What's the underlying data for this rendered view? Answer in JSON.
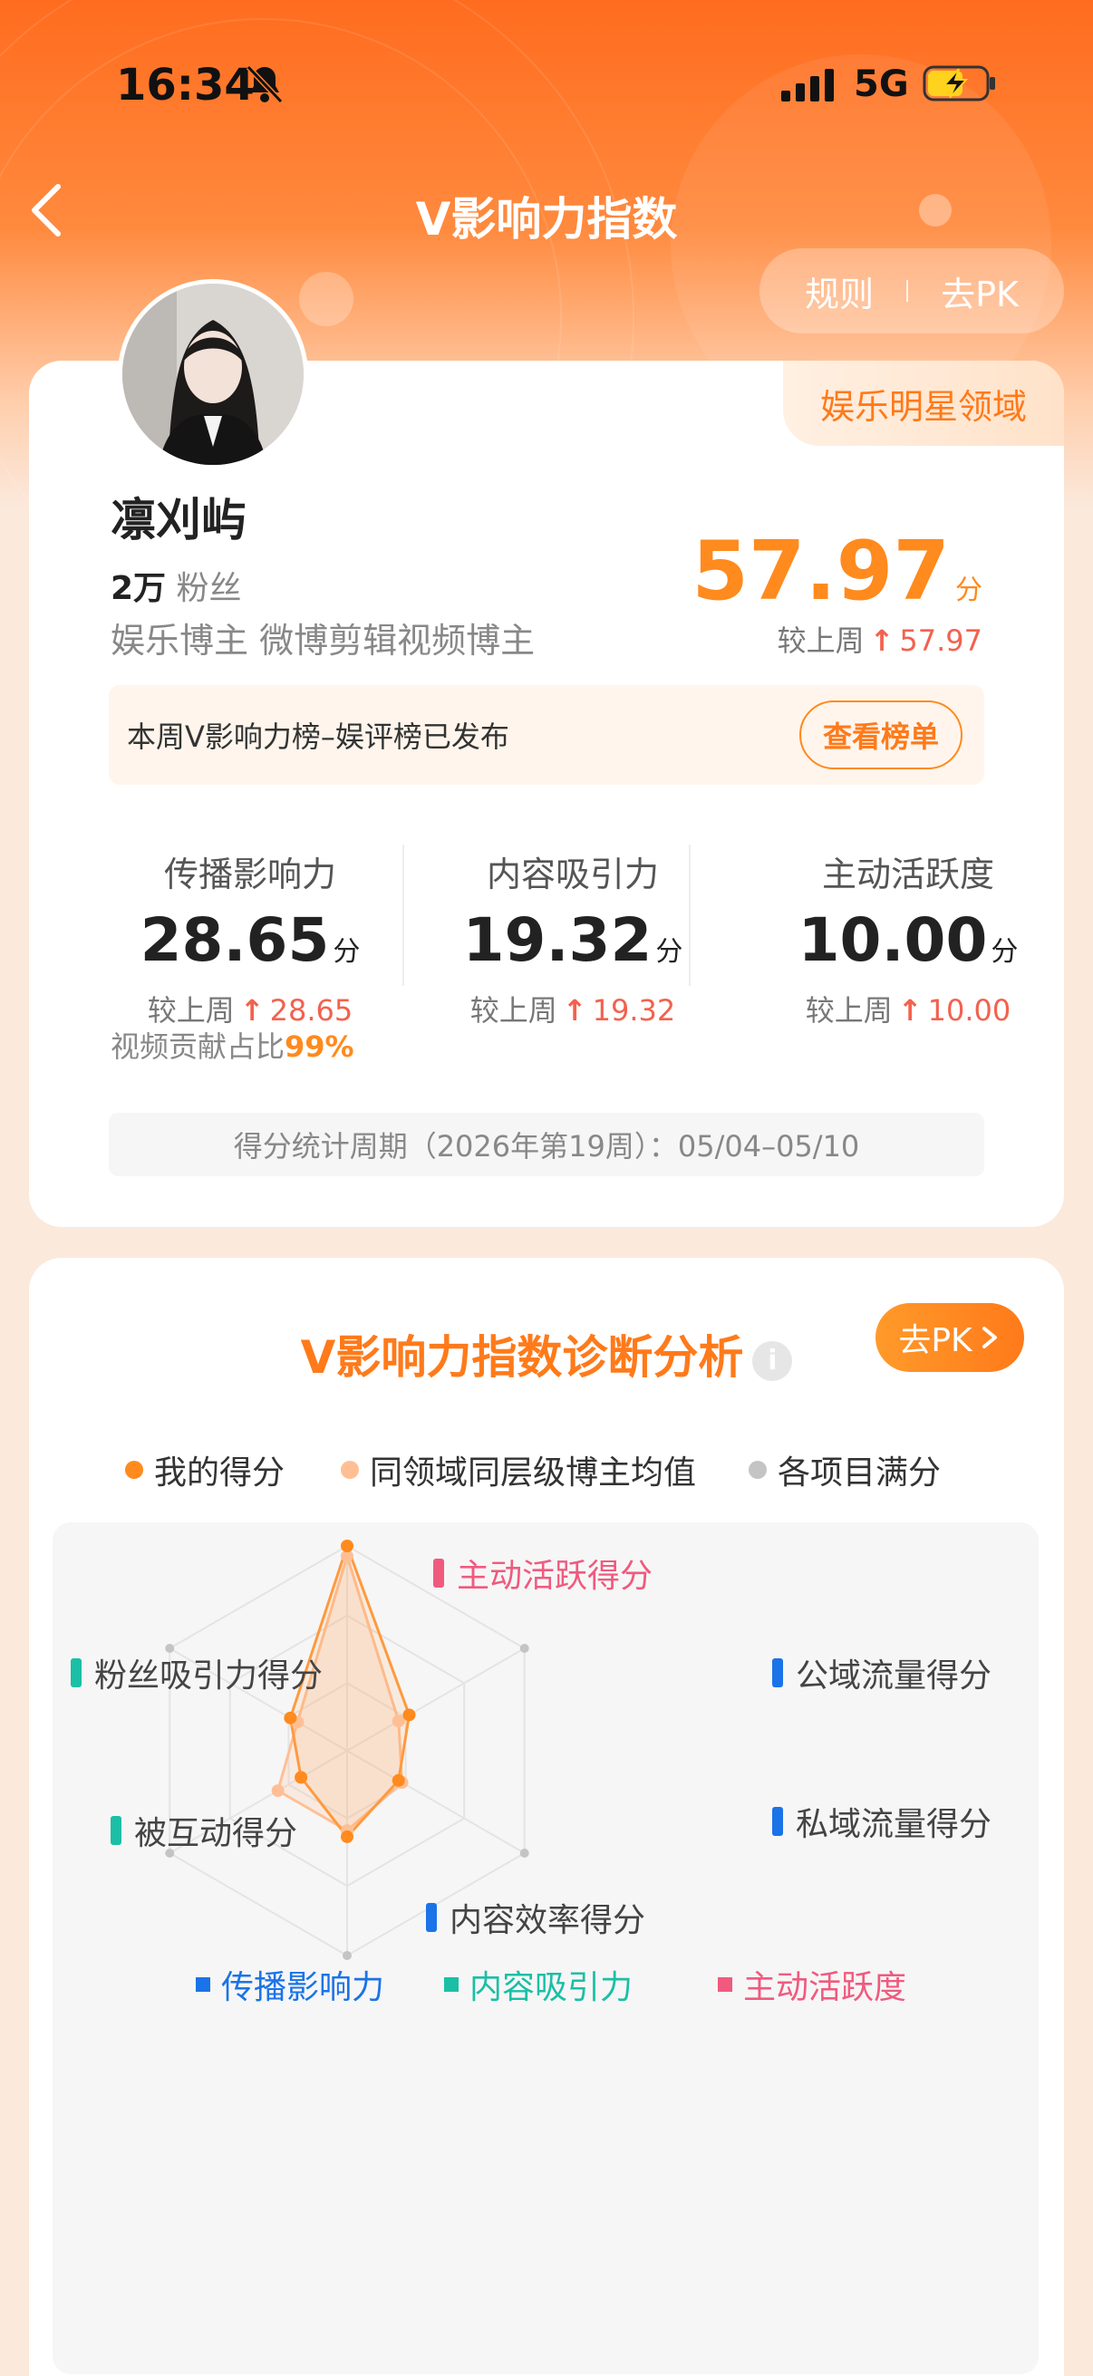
{
  "status_bar": {
    "time": "16:34",
    "network": "5G"
  },
  "header": {
    "title": "V影响力指数",
    "rules_label": "规则",
    "pk_label": "去PK"
  },
  "profile": {
    "domain_tag": "娱乐明星领域",
    "name": "凛刈屿",
    "fans_count": "2万",
    "fans_label": "粉丝",
    "tags": "娱乐博主 微博剪辑视频博主",
    "score": "57.97",
    "score_unit": "分",
    "compare_label": "较上周",
    "score_change": "57.97"
  },
  "notice": {
    "text": "本周V影响力榜–娱评榜已发布",
    "button": "查看榜单"
  },
  "metrics": [
    {
      "label": "传播影响力",
      "value": "28.65",
      "unit": "分",
      "compare_label": "较上周",
      "change": "28.65"
    },
    {
      "label": "内容吸引力",
      "value": "19.32",
      "unit": "分",
      "compare_label": "较上周",
      "change": "19.32"
    },
    {
      "label": "主动活跃度",
      "value": "10.00",
      "unit": "分",
      "compare_label": "较上周",
      "change": "10.00"
    }
  ],
  "video_share": {
    "label": "视频贡献占比",
    "value": "99%"
  },
  "period": "得分统计周期（2026年第19周）：05/04–05/10",
  "diagnosis": {
    "title": "V影响力指数诊断分析",
    "info_icon": "i",
    "pk_button": "去PK",
    "legend": [
      {
        "label": "我的得分",
        "color": "#ff8a1e"
      },
      {
        "label": "同领域同层级博主均值",
        "color": "#ffbf95"
      },
      {
        "label": "各项目满分",
        "color": "#c4c4c4"
      }
    ],
    "radar_axes": [
      {
        "label": "主动活跃得分",
        "color": "#f05a7e"
      },
      {
        "label": "公域流量得分",
        "color": "#1a73e8"
      },
      {
        "label": "私域流量得分",
        "color": "#1a73e8"
      },
      {
        "label": "内容效率得分",
        "color": "#1a73e8"
      },
      {
        "label": "被互动得分",
        "color": "#1bbfa5"
      },
      {
        "label": "粉丝吸引力得分",
        "color": "#1bbfa5"
      }
    ],
    "radar_my_fraction": [
      1.0,
      0.35,
      0.29,
      0.42,
      0.26,
      0.32
    ],
    "radar_avg_fraction": [
      0.95,
      0.29,
      0.31,
      0.39,
      0.39,
      0.28
    ],
    "bottom_legend": [
      {
        "label": "传播影响力",
        "color": "#1a73e8"
      },
      {
        "label": "内容吸引力",
        "color": "#1bbfa5"
      },
      {
        "label": "主动活跃度",
        "color": "#f05a7e"
      }
    ]
  }
}
